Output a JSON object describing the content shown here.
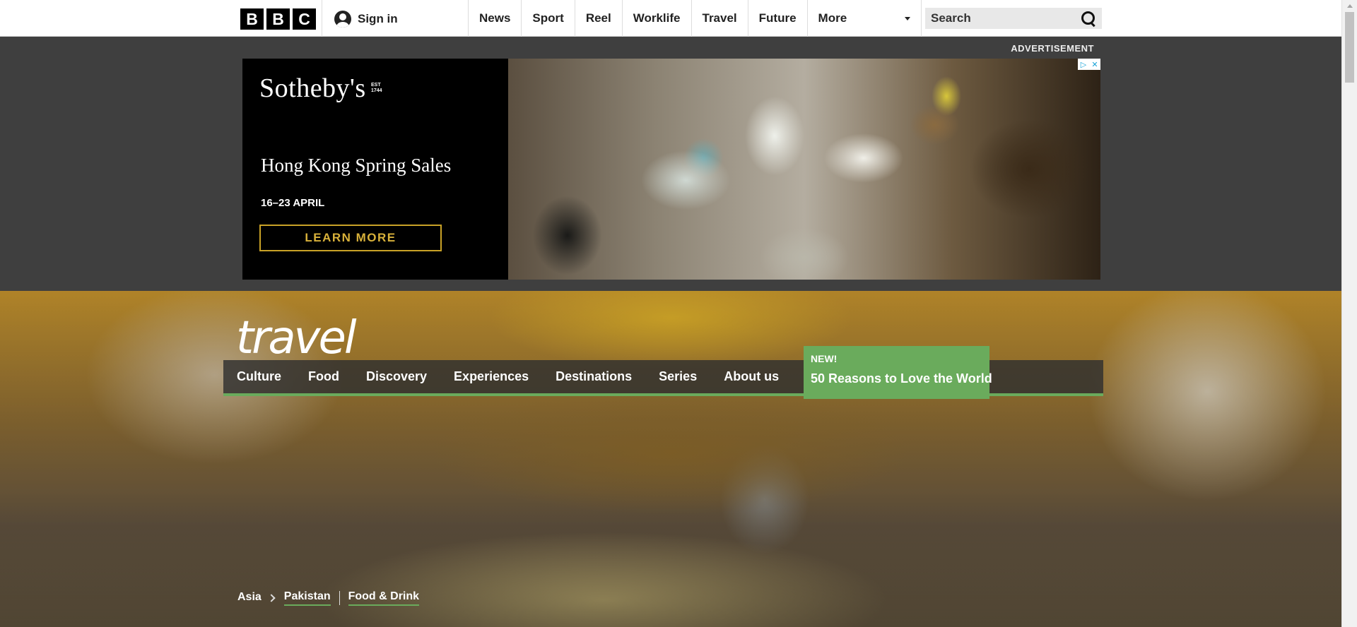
{
  "bbc": {
    "logo": [
      "B",
      "B",
      "C"
    ],
    "sign_in": "Sign in",
    "nav": [
      "News",
      "Sport",
      "Reel",
      "Worklife",
      "Travel",
      "Future"
    ],
    "more": "More",
    "search_placeholder": "Search"
  },
  "advert": {
    "label": "ADVERTISEMENT",
    "brand": "Sotheby's",
    "brand_est": "EST 1744",
    "headline": "Hong Kong Spring Sales",
    "dates": "16–23 APRIL",
    "cta": "LEARN MORE",
    "adchoices": [
      "▷",
      "✕"
    ]
  },
  "travel": {
    "logo": "travel",
    "nav": [
      "Culture",
      "Food",
      "Discovery",
      "Experiences",
      "Destinations",
      "Series",
      "About us"
    ],
    "promo_badge": "NEW!",
    "promo_title": "50 Reasons to Love the World",
    "breadcrumb": [
      "Asia",
      "Pakistan",
      "Food & Drink"
    ],
    "accent": "#6aab5c"
  }
}
